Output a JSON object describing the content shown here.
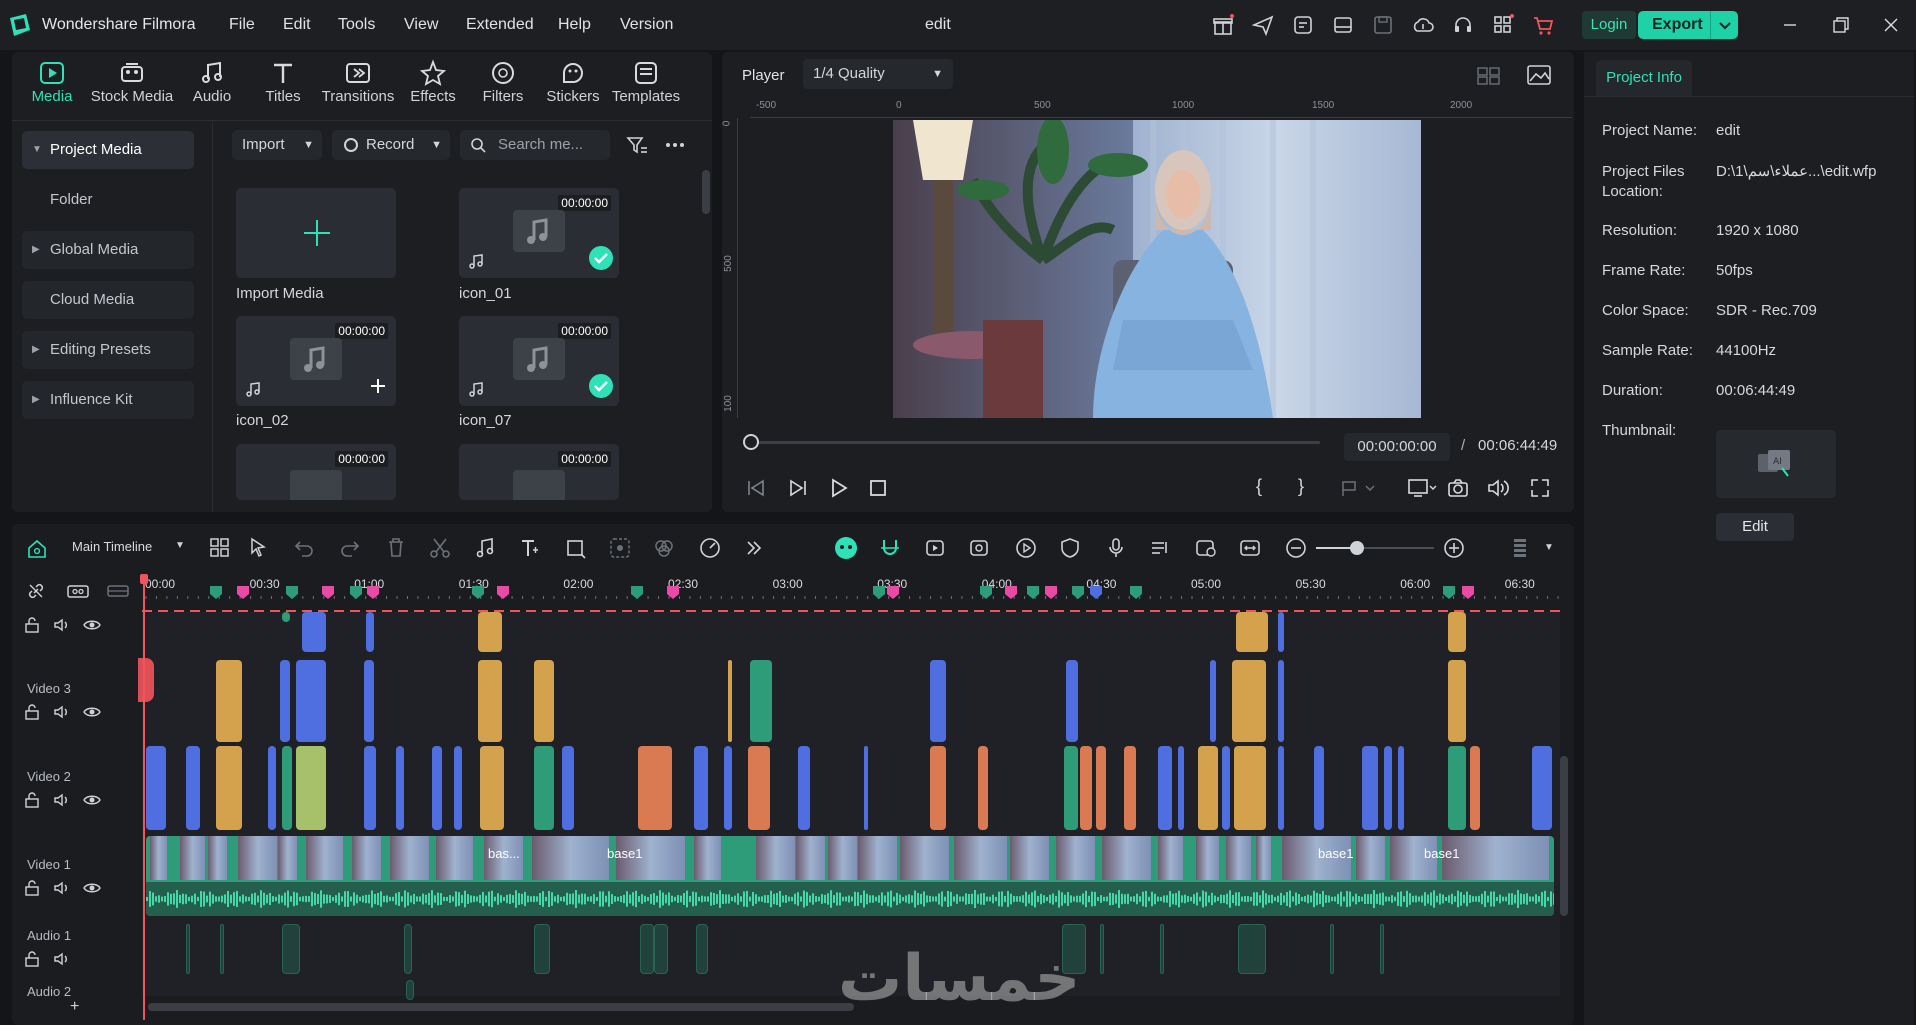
{
  "app": {
    "name": "Wondershare Filmora",
    "doc_title": "edit"
  },
  "menu": [
    "File",
    "Edit",
    "Tools",
    "View",
    "Extended",
    "Help",
    "Version"
  ],
  "topbar": {
    "login": "Login",
    "export": "Export"
  },
  "media_tabs": [
    {
      "label": "Media",
      "icon": "media-icon"
    },
    {
      "label": "Stock Media",
      "icon": "stock-media-icon"
    },
    {
      "label": "Audio",
      "icon": "audio-icon"
    },
    {
      "label": "Titles",
      "icon": "titles-icon"
    },
    {
      "label": "Transitions",
      "icon": "transitions-icon"
    },
    {
      "label": "Effects",
      "icon": "effects-icon"
    },
    {
      "label": "Filters",
      "icon": "filters-icon"
    },
    {
      "label": "Stickers",
      "icon": "stickers-icon"
    },
    {
      "label": "Templates",
      "icon": "templates-icon"
    }
  ],
  "sidebar": [
    "Project Media",
    "Folder",
    "Global Media",
    "Cloud Media",
    "Editing Presets",
    "Influence Kit"
  ],
  "media_toolbar": {
    "import": "Import",
    "record": "Record",
    "search_placeholder": "Search me..."
  },
  "media_items": [
    {
      "label": "Import Media",
      "duration": ""
    },
    {
      "label": "icon_01",
      "duration": "00:00:00"
    },
    {
      "label": "icon_02",
      "duration": "00:00:00"
    },
    {
      "label": "icon_07",
      "duration": "00:00:00"
    },
    {
      "label": "",
      "duration": "00:00:00"
    },
    {
      "label": "",
      "duration": "00:00:00"
    }
  ],
  "player": {
    "label": "Player",
    "quality": "1/4 Quality",
    "ruler_h": [
      "-500",
      "0",
      "500",
      "1000",
      "1500",
      "2000"
    ],
    "ruler_v": [
      "0",
      "500",
      "100"
    ],
    "timecode": "00:00:00:00",
    "separator": "/",
    "duration": "00:06:44:49",
    "progress": 0
  },
  "project_info": {
    "tab": "Project Info",
    "fields": [
      {
        "key": "Project Name:",
        "value": "edit"
      },
      {
        "key": "Project Files Location:",
        "value": "D:\\1\\عملاء\\سم...\\edit.wfp"
      },
      {
        "key": "Resolution:",
        "value": "1920 x 1080"
      },
      {
        "key": "Frame Rate:",
        "value": "50fps"
      },
      {
        "key": "Color Space:",
        "value": "SDR - Rec.709"
      },
      {
        "key": "Sample Rate:",
        "value": "44100Hz"
      },
      {
        "key": "Duration:",
        "value": "00:06:44:49"
      },
      {
        "key": "Thumbnail:",
        "value": ""
      }
    ],
    "edit": "Edit"
  },
  "timeline": {
    "name": "Main Timeline",
    "ruler": [
      "00:00",
      "00:30",
      "01:00",
      "01:30",
      "02:00",
      "02:30",
      "03:00",
      "03:30",
      "04:00",
      "04:30",
      "05:00",
      "05:30",
      "06:00",
      "06:30"
    ],
    "tracks": [
      "Video 3",
      "Video 2",
      "Video 1",
      "Audio 1",
      "Audio 2"
    ],
    "clip_titles": [
      "bas...",
      "base1",
      "base1",
      "base1"
    ],
    "zoom": 0.35
  },
  "watermark": "خمسات",
  "colors": {
    "accent": "#2fe1b6",
    "orange": "#d4a24c",
    "blue": "#4f6fe0",
    "green": "#2f9c79",
    "red": "#f2545b",
    "pink": "#e94aa5"
  }
}
